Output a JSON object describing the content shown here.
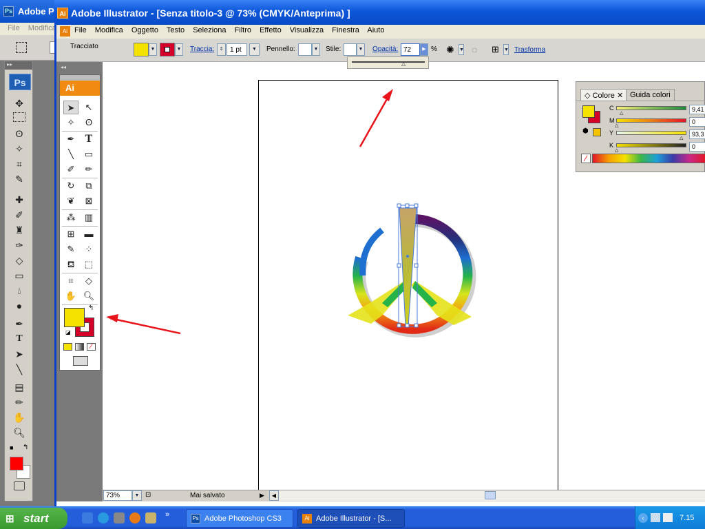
{
  "photoshop": {
    "title": "Adobe P",
    "logo": "Ps",
    "menu": [
      "File",
      "Modifica"
    ],
    "tools_logo": "Ps",
    "foreground_color": "#ff0000",
    "background_color": "#ffffff"
  },
  "illustrator": {
    "title": "Adobe Illustrator - [Senza titolo-3 @ 73% (CMYK/Anteprima) ]",
    "logo": "Ai",
    "menu": [
      "File",
      "Modifica",
      "Oggetto",
      "Testo",
      "Seleziona",
      "Filtro",
      "Effetto",
      "Visualizza",
      "Finestra",
      "Aiuto"
    ],
    "control": {
      "selection": "Tracciato",
      "fill_color": "#f5e200",
      "stroke_color": "#d4002a",
      "stroke_label": "Traccia:",
      "stroke_weight": "1 pt",
      "brush_label": "Pennello:",
      "style_label": "Stile:",
      "opacity_label": "Opacità:",
      "opacity_value": "72",
      "opacity_unit": "%",
      "transform_label": "Trasforma"
    },
    "tools_logo": "Ai",
    "fill_swatch": "#f5e200",
    "stroke_swatch": "#d4002a",
    "status": {
      "zoom": "73%",
      "save_state": "Mai salvato"
    }
  },
  "color_panel": {
    "tabs": [
      "Colore",
      "Guida colori"
    ],
    "channels": [
      {
        "label": "C",
        "value": "9,41"
      },
      {
        "label": "M",
        "value": "0"
      },
      {
        "label": "Y",
        "value": "93,3"
      },
      {
        "label": "K",
        "value": "0"
      }
    ]
  },
  "taskbar": {
    "start_label": "start",
    "buttons": [
      "Adobe Photoshop CS3",
      "Adobe Illustrator - [S..."
    ],
    "clock": "7.15"
  }
}
